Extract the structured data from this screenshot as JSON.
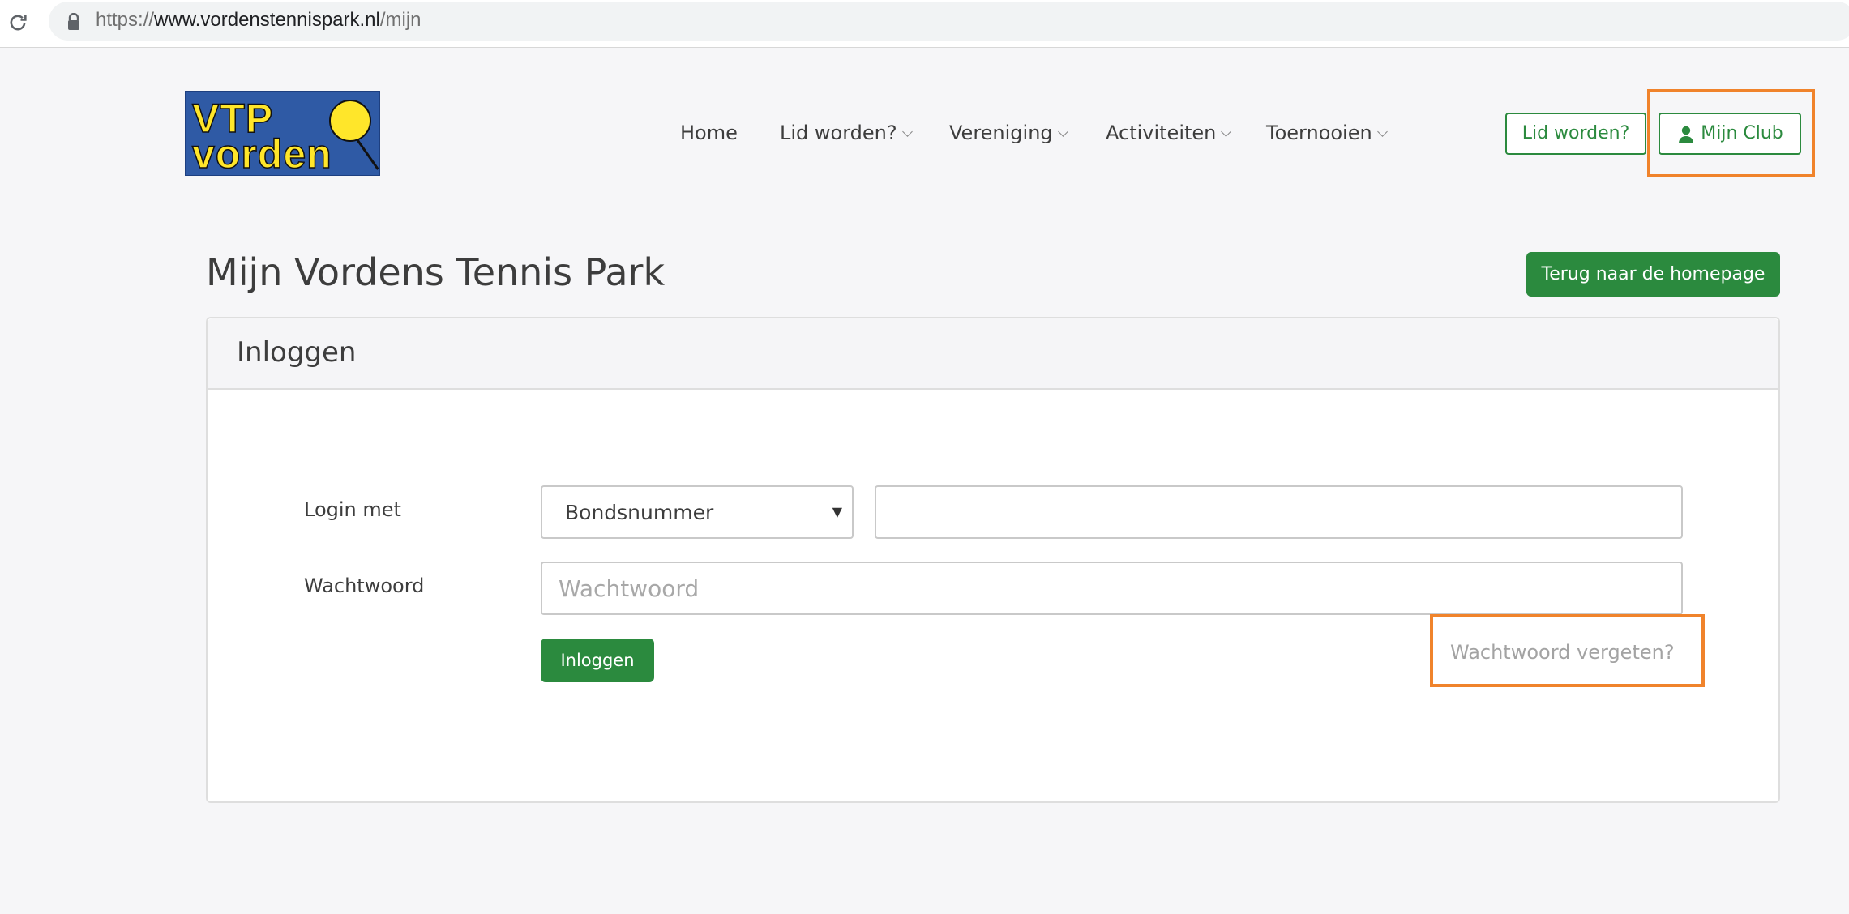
{
  "browser": {
    "url_protocol": "https://",
    "url_host": "www.vordenstennispark.nl",
    "url_path": "/mijn"
  },
  "logo": {
    "line1": "VTP",
    "line2": "vorden"
  },
  "nav": {
    "items": [
      {
        "label": "Home",
        "has_dropdown": false
      },
      {
        "label": "Lid worden?",
        "has_dropdown": true
      },
      {
        "label": "Vereniging",
        "has_dropdown": true
      },
      {
        "label": "Activiteiten",
        "has_dropdown": true
      },
      {
        "label": "Toernooien",
        "has_dropdown": true
      }
    ],
    "lid_button": "Lid worden?",
    "mijn_club_button": "Mijn Club"
  },
  "page": {
    "title": "Mijn Vordens Tennis Park",
    "back_button": "Terug naar de homepage"
  },
  "panel": {
    "title": "Inloggen",
    "login_label": "Login met",
    "login_method_selected": "Bondsnummer",
    "login_id_value": "",
    "password_label": "Wachtwoord",
    "password_placeholder": "Wachtwoord",
    "submit_button": "Inloggen",
    "forgot_link": "Wachtwoord vergeten?"
  },
  "colors": {
    "accent_green": "#2b8a3e",
    "highlight_orange": "#f0832b",
    "page_background": "#f6f6f8"
  },
  "icons": [
    "reload-icon",
    "lock-icon",
    "chevron-down-icon",
    "user-icon"
  ]
}
